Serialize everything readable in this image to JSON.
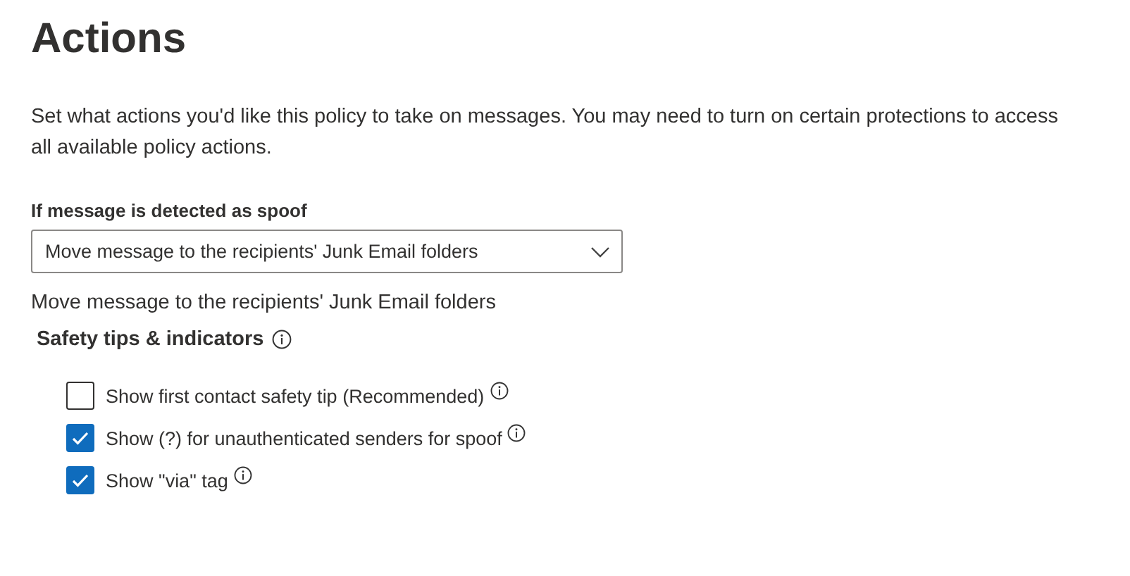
{
  "title": "Actions",
  "description": "Set what actions you'd like this policy to take on messages. You may need to turn on certain protections to access all available policy actions.",
  "spoof_action": {
    "label": "If message is detected as spoof",
    "value": "Move message to the recipients' Junk Email folders",
    "summary": "Move message to the recipients' Junk Email folders"
  },
  "safety_tips": {
    "heading": "Safety tips & indicators",
    "options": [
      {
        "label": "Show first contact safety tip (Recommended)",
        "checked": false
      },
      {
        "label": "Show (?) for unauthenticated senders for spoof",
        "checked": true
      },
      {
        "label": "Show \"via\" tag",
        "checked": true
      }
    ]
  }
}
